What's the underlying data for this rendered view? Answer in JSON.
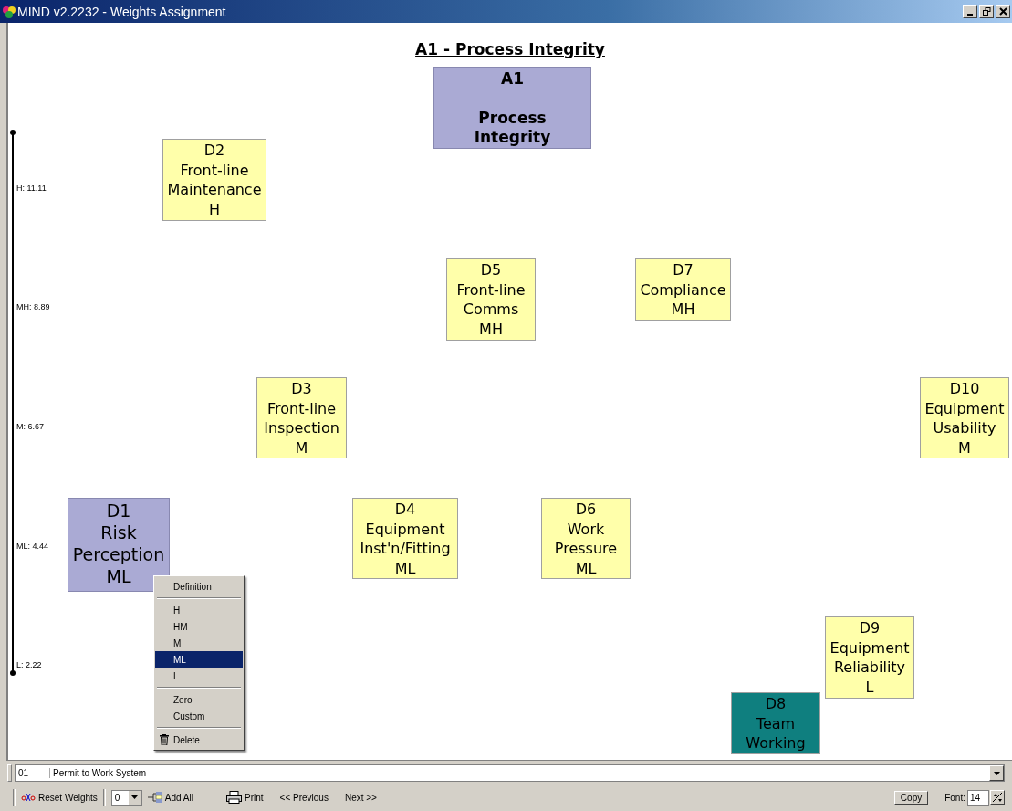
{
  "window": {
    "title": "MIND v2.2232 - Weights Assignment"
  },
  "canvas": {
    "title": "A1 - Process Integrity",
    "root": {
      "id": "A1",
      "name": "Process Integrity"
    },
    "scale": [
      {
        "label": "H: 11.11"
      },
      {
        "label": "MH: 8.89"
      },
      {
        "label": "M: 6.67"
      },
      {
        "label": "ML: 4.44"
      },
      {
        "label": "L: 2.22"
      }
    ],
    "nodes": [
      {
        "id": "D2",
        "name": "Front-line Maintenance",
        "weight": "H",
        "color": "#ffffaa",
        "selected": false
      },
      {
        "id": "D5",
        "name": "Front-line Comms",
        "weight": "MH",
        "color": "#ffffaa",
        "selected": false
      },
      {
        "id": "D7",
        "name": "Compliance",
        "weight": "MH",
        "color": "#ffffaa",
        "selected": false
      },
      {
        "id": "D3",
        "name": "Front-line Inspection",
        "weight": "M",
        "color": "#ffffaa",
        "selected": false
      },
      {
        "id": "D10",
        "name": "Equipment Usability",
        "weight": "M",
        "color": "#ffffaa",
        "selected": false
      },
      {
        "id": "D1",
        "name": "Risk Perception",
        "weight": "ML",
        "color": "#aaaad4",
        "selected": true
      },
      {
        "id": "D4",
        "name": "Equipment Inst'n/Fitting",
        "weight": "ML",
        "color": "#ffffaa",
        "selected": false
      },
      {
        "id": "D6",
        "name": "Work Pressure",
        "weight": "ML",
        "color": "#ffffaa",
        "selected": false
      },
      {
        "id": "D9",
        "name": "Equipment Reliability",
        "weight": "L",
        "color": "#ffffaa",
        "selected": false
      },
      {
        "id": "D8",
        "name": "Team Working",
        "color": "#0f7f7f",
        "selected": false
      }
    ]
  },
  "context_menu": {
    "groups": [
      [
        {
          "label": "Definition",
          "kind": "text",
          "selected": false
        }
      ],
      [
        {
          "label": "H",
          "kind": "text",
          "selected": false
        },
        {
          "label": "HM",
          "kind": "text",
          "selected": false
        },
        {
          "label": "M",
          "kind": "text",
          "selected": false
        },
        {
          "label": "ML",
          "kind": "text",
          "selected": true
        },
        {
          "label": "L",
          "kind": "text",
          "selected": false
        }
      ],
      [
        {
          "label": "Zero",
          "kind": "text",
          "selected": false
        },
        {
          "label": "Custom",
          "kind": "text",
          "selected": false
        }
      ],
      [
        {
          "label": "Delete",
          "kind": "trash",
          "selected": false
        }
      ]
    ]
  },
  "system_select": {
    "code": "01",
    "name": "Permit to Work System"
  },
  "toolbar": {
    "reset": "Reset Weights",
    "count": "0",
    "add_all": "Add All",
    "print": "Print",
    "previous": "<< Previous",
    "next": "Next >>",
    "copy": "Copy",
    "font_label": "Font:",
    "font_size": "14"
  }
}
